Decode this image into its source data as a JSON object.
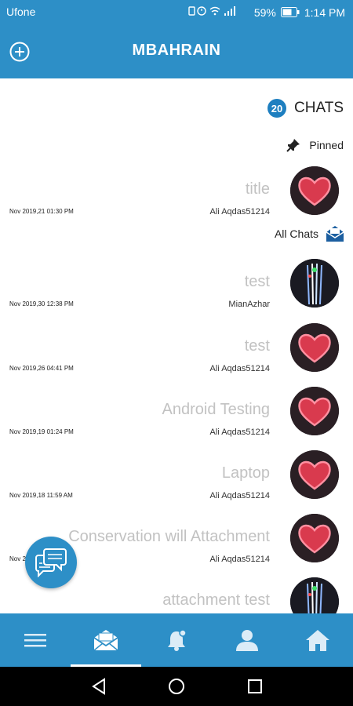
{
  "status_bar": {
    "carrier": "Ufone",
    "battery": "59%",
    "time": "1:14 PM"
  },
  "app_bar": {
    "title": "MBAHRAIN"
  },
  "chats_header": {
    "count": "20",
    "label": "CHATS"
  },
  "pinned": {
    "label": "Pinned"
  },
  "all_chats": {
    "label": "All Chats"
  },
  "pinned_chats": [
    {
      "name": "title",
      "user": "Ali Aqdas51214",
      "date": "Nov 2019,21 01:30 PM",
      "avatar": "heart"
    }
  ],
  "chats": [
    {
      "name": "test",
      "user": "MianAzhar",
      "date": "Nov 2019,30 12:38 PM",
      "avatar": "lights"
    },
    {
      "name": "test",
      "user": "Ali Aqdas51214",
      "date": "Nov 2019,26 04:41 PM",
      "avatar": "heart"
    },
    {
      "name": "Android Testing",
      "user": "Ali Aqdas51214",
      "date": "Nov 2019,19 01:24 PM",
      "avatar": "heart"
    },
    {
      "name": "Laptop",
      "user": "Ali Aqdas51214",
      "date": "Nov 2019,18 11:59 AM",
      "avatar": "heart"
    },
    {
      "name": "Conservation will Attachment",
      "user": "Ali Aqdas51214",
      "date": "Nov 2019,18 11:59 AM",
      "avatar": "heart"
    },
    {
      "name": "attachment test",
      "user": "",
      "date": "",
      "avatar": "lights"
    }
  ],
  "bottom_nav": [
    {
      "name": "menu-icon",
      "active": false
    },
    {
      "name": "mail-icon",
      "active": true
    },
    {
      "name": "bell-icon",
      "active": false
    },
    {
      "name": "profile-icon",
      "active": false
    },
    {
      "name": "home-icon",
      "active": false
    }
  ],
  "colors": {
    "primary": "#2d8fc7",
    "badge": "#1e7fc0",
    "chat_name": "#c2c2c2"
  }
}
